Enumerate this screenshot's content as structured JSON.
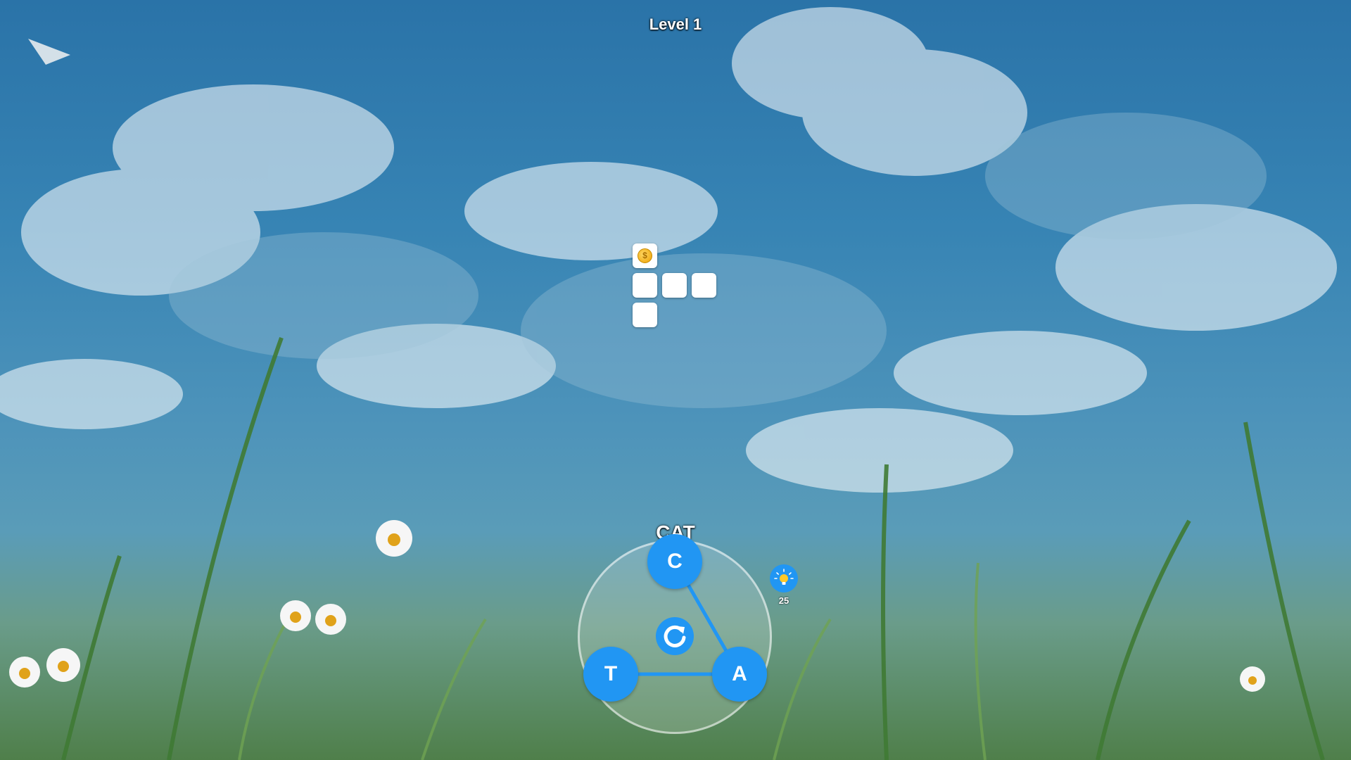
{
  "game": {
    "level_title": "Level 1",
    "current_word": "CAT",
    "letters": {
      "c": "C",
      "t": "T",
      "a": "A"
    },
    "hint_count": "25",
    "coin_symbol": "$"
  },
  "colors": {
    "accent": "#2196f3",
    "tile": "#ffffff",
    "coin": "#f2b01e"
  }
}
